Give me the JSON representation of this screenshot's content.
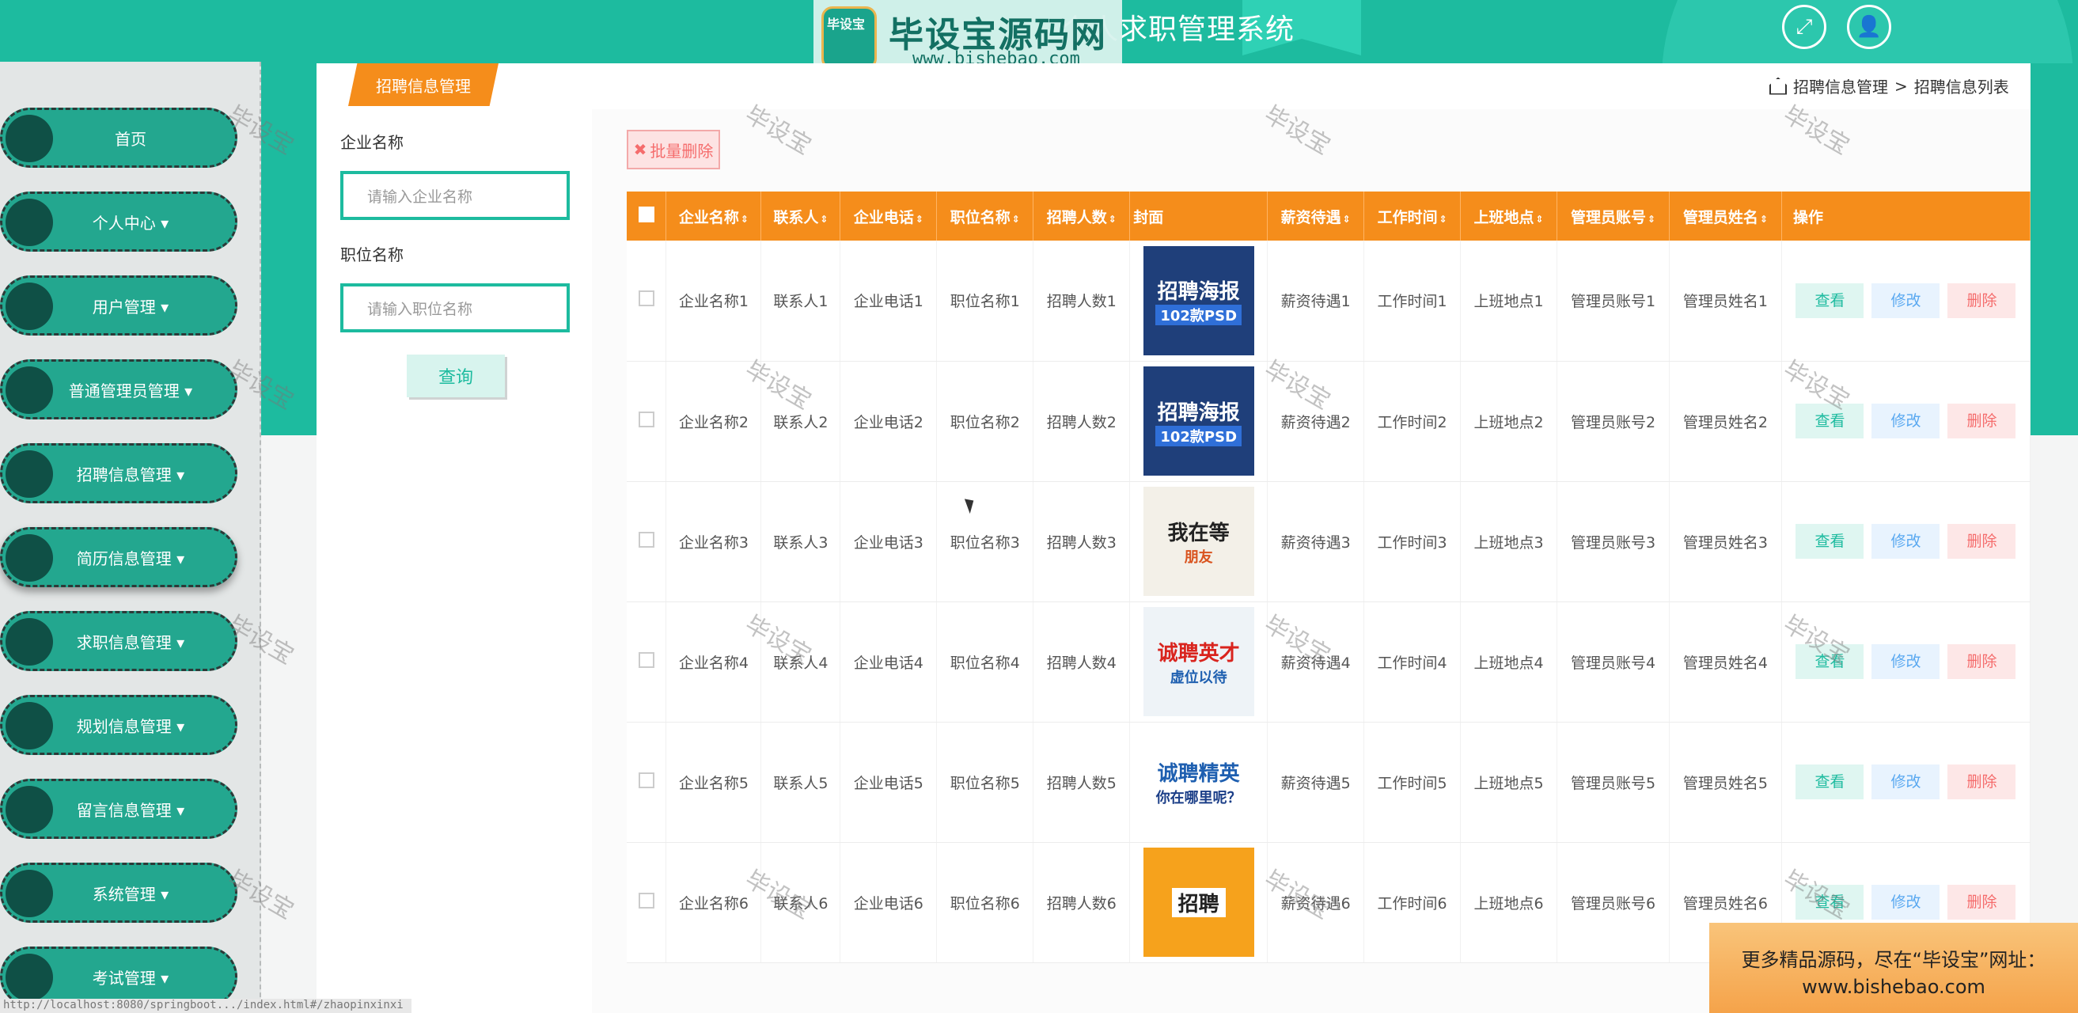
{
  "header": {
    "title": "个人求职管理系统"
  },
  "logo": {
    "badge": "毕设宝",
    "name": "毕设宝源码网",
    "url": "www.bishebao.com"
  },
  "sidebar": {
    "items": [
      {
        "label": "首页"
      },
      {
        "label": "个人中心 ▾"
      },
      {
        "label": "用户管理 ▾"
      },
      {
        "label": "普通管理员管理 ▾"
      },
      {
        "label": "招聘信息管理 ▾"
      },
      {
        "label": "简历信息管理 ▾"
      },
      {
        "label": "求职信息管理 ▾"
      },
      {
        "label": "规划信息管理 ▾"
      },
      {
        "label": "留言信息管理 ▾"
      },
      {
        "label": "系统管理 ▾"
      },
      {
        "label": "考试管理 ▾"
      }
    ]
  },
  "page": {
    "tab": "招聘信息管理"
  },
  "breadcrumb": {
    "root": "招聘信息管理",
    "sep": ">",
    "current": "招聘信息列表"
  },
  "search": {
    "company_label": "企业名称",
    "company_placeholder": "请输入企业名称",
    "position_label": "职位名称",
    "position_placeholder": "请输入职位名称",
    "query_button": "查询"
  },
  "toolbar": {
    "batch_delete": "批量删除"
  },
  "table": {
    "columns": [
      "企业名称",
      "联系人",
      "企业电话",
      "职位名称",
      "招聘人数",
      "封面",
      "薪资待遇",
      "工作时间",
      "上班地点",
      "管理员账号",
      "管理员姓名",
      "操作"
    ],
    "actions": {
      "view": "查看",
      "edit": "修改",
      "delete": "删除"
    },
    "rows": [
      {
        "company": "企业名称1",
        "contact": "联系人1",
        "phone": "企业电话1",
        "position": "职位名称1",
        "count": "招聘人数1",
        "cover_t1": "招聘海报",
        "cover_t2": "102款PSD",
        "salary": "薪资待遇1",
        "time": "工作时间1",
        "place": "上班地点1",
        "admin_acc": "管理员账号1",
        "admin_name": "管理员姓名1"
      },
      {
        "company": "企业名称2",
        "contact": "联系人2",
        "phone": "企业电话2",
        "position": "职位名称2",
        "count": "招聘人数2",
        "cover_t1": "招聘海报",
        "cover_t2": "102款PSD",
        "salary": "薪资待遇2",
        "time": "工作时间2",
        "place": "上班地点2",
        "admin_acc": "管理员账号2",
        "admin_name": "管理员姓名2"
      },
      {
        "company": "企业名称3",
        "contact": "联系人3",
        "phone": "企业电话3",
        "position": "职位名称3",
        "count": "招聘人数3",
        "cover_t1": "我在等",
        "cover_t2": "朋友",
        "salary": "薪资待遇3",
        "time": "工作时间3",
        "place": "上班地点3",
        "admin_acc": "管理员账号3",
        "admin_name": "管理员姓名3"
      },
      {
        "company": "企业名称4",
        "contact": "联系人4",
        "phone": "企业电话4",
        "position": "职位名称4",
        "count": "招聘人数4",
        "cover_t1": "诚聘英才",
        "cover_t2": "虚位以待",
        "salary": "薪资待遇4",
        "time": "工作时间4",
        "place": "上班地点4",
        "admin_acc": "管理员账号4",
        "admin_name": "管理员姓名4"
      },
      {
        "company": "企业名称5",
        "contact": "联系人5",
        "phone": "企业电话5",
        "position": "职位名称5",
        "count": "招聘人数5",
        "cover_t1": "诚聘精英",
        "cover_t2": "你在哪里呢？",
        "salary": "薪资待遇5",
        "time": "工作时间5",
        "place": "上班地点5",
        "admin_acc": "管理员账号5",
        "admin_name": "管理员姓名5"
      },
      {
        "company": "企业名称6",
        "contact": "联系人6",
        "phone": "企业电话6",
        "position": "职位名称6",
        "count": "招聘人数6",
        "cover_t1": "招聘",
        "cover_t2": "",
        "salary": "薪资待遇6",
        "time": "工作时间6",
        "place": "上班地点6",
        "admin_acc": "管理员账号6",
        "admin_name": "管理员姓名6"
      }
    ]
  },
  "watermark": "毕设宝",
  "ad": {
    "line1": "更多精品源码，尽在“毕设宝”网址：",
    "line2": "www.bishebao.com"
  },
  "statusbar": "http://localhost:8080/springboot.../index.html#/zhaopinxinxi",
  "colors": {
    "primary": "#1dbb9f",
    "orange": "#f58d1b",
    "danger": "#f56c6c",
    "info": "#5aa9f1"
  },
  "icons": {
    "fullscreen": "fullscreen-icon",
    "user": "user-icon",
    "home": "home-icon",
    "close": "close-icon"
  }
}
